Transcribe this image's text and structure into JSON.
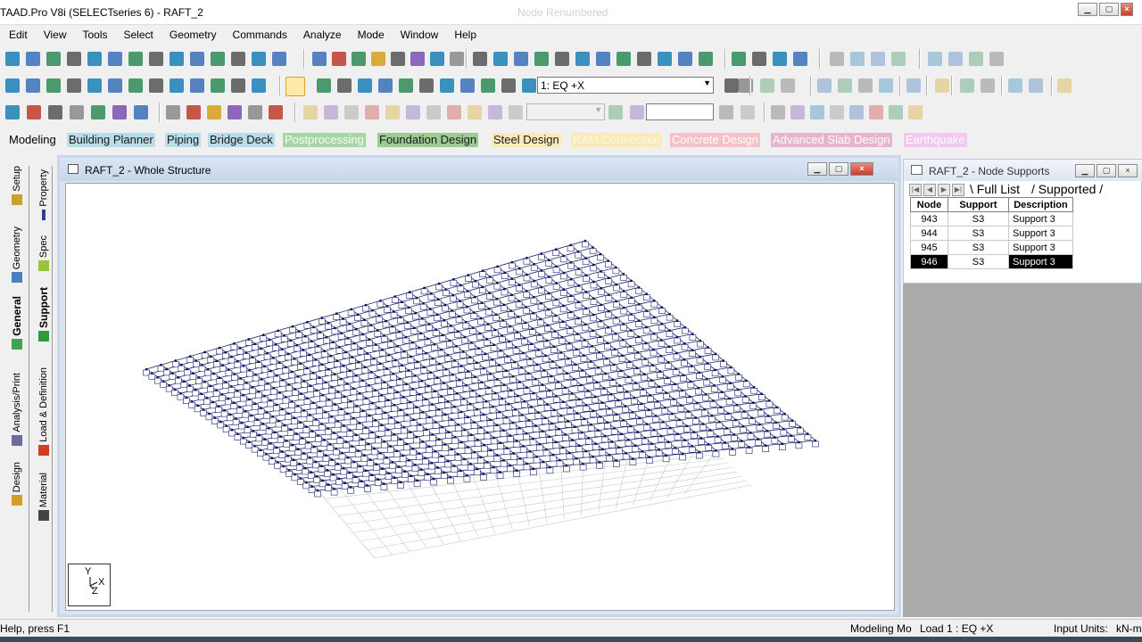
{
  "window": {
    "title": "TAAD.Pro V8i (SELECTseries 6) - RAFT_2",
    "ghost_text": "Node    Renumbered"
  },
  "menu": [
    "Edit",
    "View",
    "Tools",
    "Select",
    "Geometry",
    "Commands",
    "Analyze",
    "Mode",
    "Window",
    "Help"
  ],
  "toolbar": {
    "load_case": "1: EQ +X"
  },
  "page_control": {
    "tabs": [
      {
        "label": "Modeling",
        "bg": "#f0f0f0",
        "color": "#000000"
      },
      {
        "label": "Building Planner",
        "bg": "#b7dde8",
        "color": "#1a1a1a"
      },
      {
        "label": "Piping",
        "bg": "#b7dde8",
        "color": "#1a1a1a"
      },
      {
        "label": "Bridge Deck",
        "bg": "#b7dde8",
        "color": "#1a1a1a"
      },
      {
        "label": "Postprocessing",
        "bg": "#a7d6a5",
        "color": "#f4fff4"
      },
      {
        "label": "Foundation Design",
        "bg": "#9ccc94",
        "color": "#1a1a1a"
      },
      {
        "label": "Steel Design",
        "bg": "#fbe9b8",
        "color": "#1a1a1a"
      },
      {
        "label": "RAM Connection",
        "bg": "#fbe9b8",
        "color": "#fff7e0"
      },
      {
        "label": "Concrete Design",
        "bg": "#f4c2c6",
        "color": "#ffffff"
      },
      {
        "label": "Advanced Slab Design",
        "bg": "#e8b4cc",
        "color": "#ffffff"
      },
      {
        "label": "Earthquake",
        "bg": "#f2c8f0",
        "color": "#ffffff"
      }
    ]
  },
  "left_tabs": {
    "outer": [
      "Setup",
      "Geometry",
      "General",
      "Analysis/Print",
      "Design"
    ],
    "inner": [
      "Property",
      "Spec",
      "Support",
      "Load & Definition",
      "Material"
    ]
  },
  "main_window": {
    "title": "RAFT_2 - Whole Structure",
    "axis_y": "Y",
    "axis_x": "X",
    "axis_z": "Z"
  },
  "supports_window": {
    "title": "RAFT_2 - Node Supports",
    "tab_full": "Full List",
    "tab_supported": "Supported",
    "columns": [
      "Node",
      "Support",
      "Description"
    ],
    "rows": [
      {
        "node": "943",
        "support": "S3",
        "description": "Support 3"
      },
      {
        "node": "944",
        "support": "S3",
        "description": "Support 3"
      },
      {
        "node": "945",
        "support": "S3",
        "description": "Support 3"
      },
      {
        "node": "946",
        "support": "S3",
        "description": "Support 3"
      }
    ]
  },
  "status": {
    "help": "Help, press F1",
    "mode": "Modeling Mo",
    "load": "Load 1 : EQ +X",
    "units_label": "Input Units:",
    "units_value": "kN-m"
  }
}
